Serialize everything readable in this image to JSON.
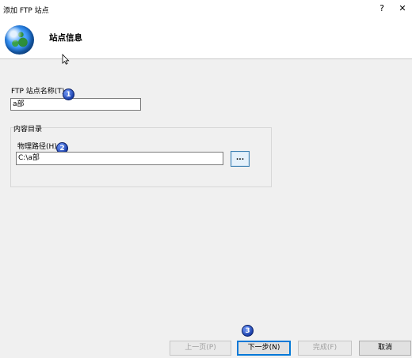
{
  "window": {
    "title": "添加 FTP 站点",
    "help_glyph": "?",
    "close_glyph": "✕"
  },
  "header": {
    "icon": "globe-icon",
    "title": "站点信息"
  },
  "site_name": {
    "label": "FTP 站点名称(T):",
    "value": "a部"
  },
  "content_directory": {
    "group_label": "内容目录",
    "path_label": "物理路径(H):",
    "path_value": "C:\\a部",
    "browse_label": "..."
  },
  "buttons": {
    "previous": "上一页(P)",
    "next": "下一步(N)",
    "finish": "完成(F)",
    "cancel": "取消"
  },
  "badges": [
    "1",
    "2",
    "3"
  ],
  "colors": {
    "badge": "#1a3fa8",
    "focus": "#0078d7"
  }
}
